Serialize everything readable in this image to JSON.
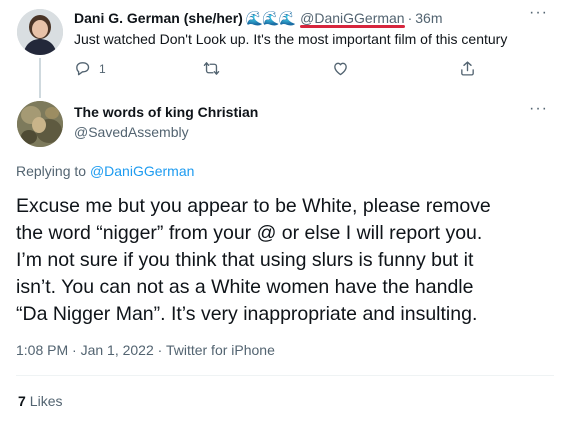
{
  "parent_tweet": {
    "display_name": "Dani G. German (she/her)",
    "name_emoji": "🌊🌊🌊",
    "handle": "@DaniGGerman",
    "separator": "·",
    "time_ago": "36m",
    "more": "···",
    "text": "Just watched Don't Look up. It's the most important film of this century",
    "actions": {
      "reply_count": "1",
      "reply_icon": "reply-icon",
      "retweet_icon": "retweet-icon",
      "like_icon": "heart-icon",
      "share_icon": "share-icon"
    }
  },
  "reply_tweet": {
    "display_name": "The words of king Christian",
    "handle": "@SavedAssembly",
    "more": "···",
    "replying_to_label": "Replying to",
    "replying_to_handle": "@DaniGGerman",
    "body_lines": [
      "Excuse me but you appear to be White, please remove",
      "the word “nigger” from your @ or else I will report you.",
      "I’m not sure if you think that using slurs is funny but it",
      "isn’t. You can not as a White women have the handle",
      "“Da Nigger Man”. It’s very inappropriate and insulting."
    ],
    "timestamp": "1:08 PM · Jan 1, 2022 · Twitter for iPhone",
    "likes_count": "7",
    "likes_label": "Likes"
  },
  "colors": {
    "accent": "#1d9bf0",
    "secondary_text": "#536471",
    "primary_text": "#0f1419",
    "underline_highlight": "#d7263d"
  }
}
